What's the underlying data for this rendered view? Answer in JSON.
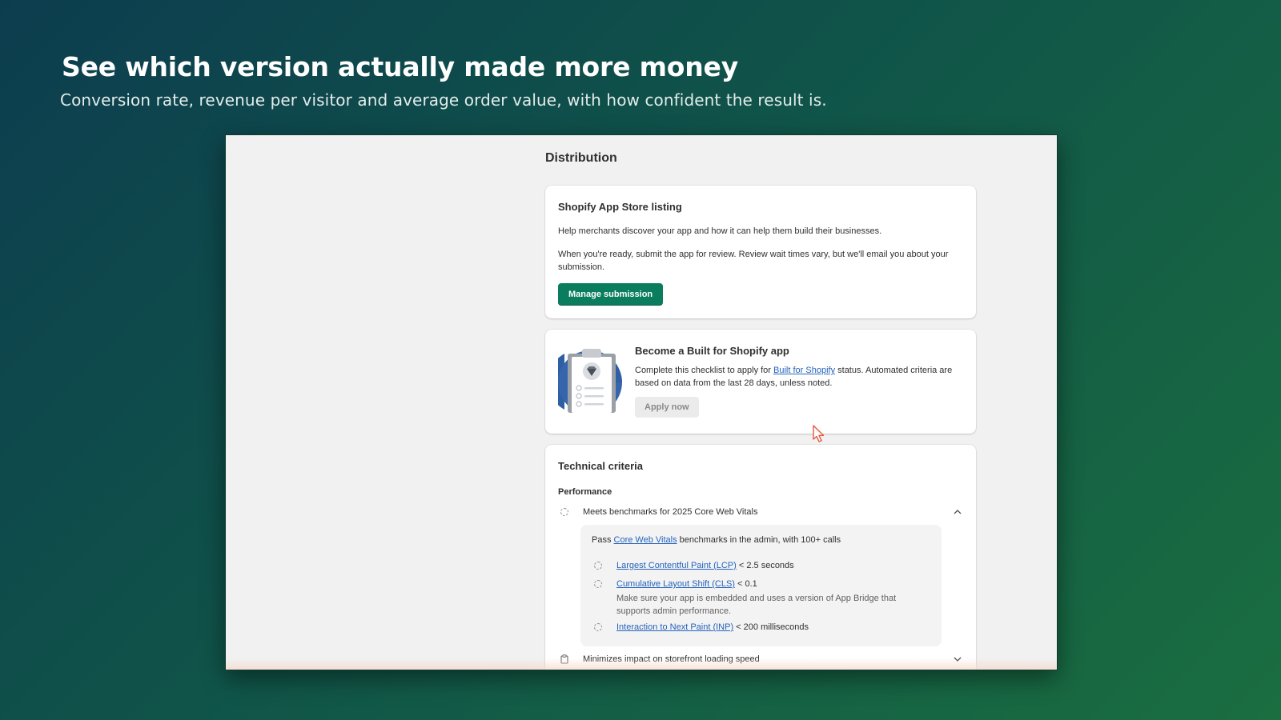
{
  "hero": {
    "title": "See which version actually made more money",
    "subtitle": "Conversion rate, revenue per visitor and average order value, with how confident the result is."
  },
  "distribution": {
    "title": "Distribution",
    "listing_card": {
      "heading": "Shopify App Store listing",
      "text1": "Help merchants discover your app and how it can help them build their businesses.",
      "text2": "When you're ready, submit the app for review. Review wait times vary, but we'll email you about your submission.",
      "button": "Manage submission"
    },
    "bfs_card": {
      "heading": "Become a Built for Shopify app",
      "text_before": "Complete this checklist to apply for ",
      "link": "Built for Shopify",
      "text_after": " status. Automated criteria are based on data from the last 28 days, unless noted.",
      "button": "Apply now"
    },
    "technical_card": {
      "heading": "Technical criteria",
      "performance_label": "Performance",
      "cwv_item": "Meets benchmarks for 2025 Core Web Vitals",
      "pass_before": "Pass ",
      "pass_link": "Core Web Vitals",
      "pass_after": " benchmarks in the admin, with 100+ calls",
      "metrics": [
        {
          "link": "Largest Contentful Paint (LCP)",
          "value": " < 2.5 seconds",
          "note": ""
        },
        {
          "link": "Cumulative Layout Shift (CLS)",
          "value": " < 0.1",
          "note": "Make sure your app is embedded and uses a version of App Bridge that supports admin performance."
        },
        {
          "link": "Interaction to Next Paint (INP)",
          "value": " < 200 milliseconds",
          "note": ""
        }
      ],
      "storefront_item": "Minimizes impact on storefront loading speed"
    }
  },
  "colors": {
    "primary_button": "#0a7d5e",
    "link": "#2463bc"
  }
}
